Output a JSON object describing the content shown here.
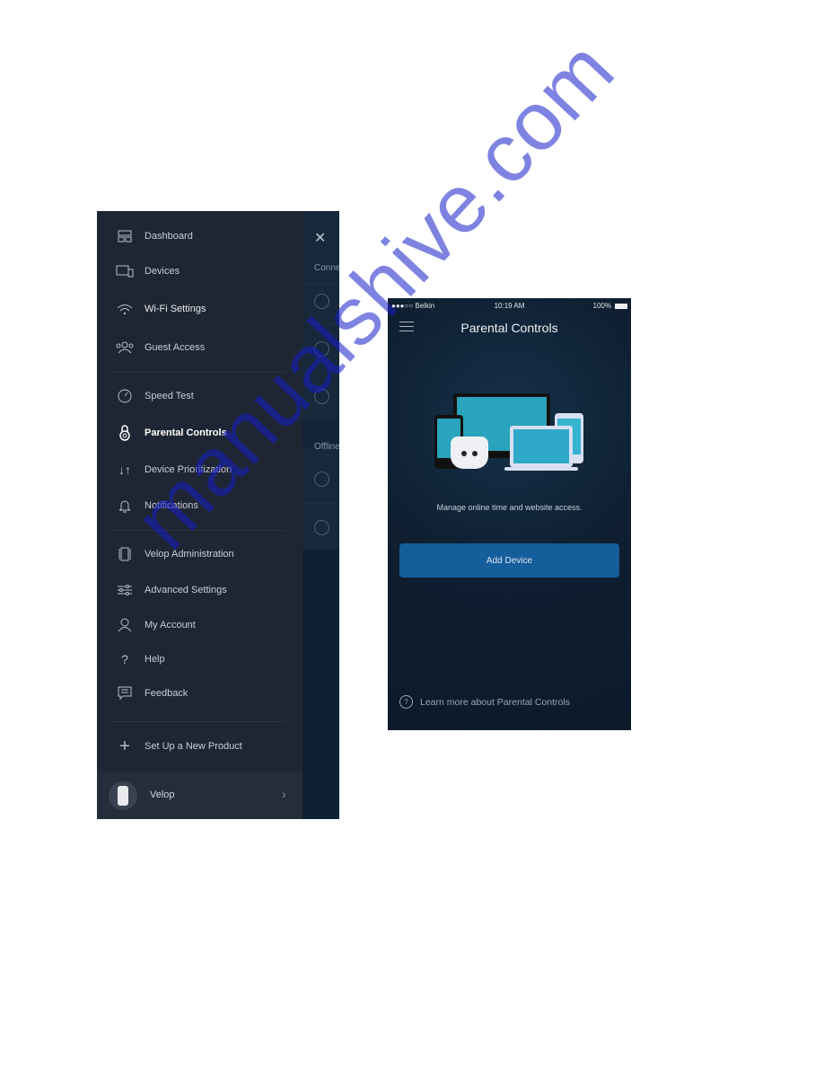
{
  "menu_screen": {
    "items": [
      {
        "label": "Dashboard",
        "icon": "dashboard-icon"
      },
      {
        "label": "Devices",
        "icon": "devices-icon"
      },
      {
        "label": "Wi-Fi Settings",
        "icon": "wifi-icon"
      },
      {
        "label": "Guest Access",
        "icon": "guest-icon"
      },
      {
        "label": "Speed Test",
        "icon": "speedometer-icon"
      },
      {
        "label": "Parental Controls",
        "icon": "lock-icon",
        "active": true
      },
      {
        "label": "Device Prioritization",
        "icon": "arrows-icon"
      },
      {
        "label": "Notifications",
        "icon": "bell-icon"
      },
      {
        "label": "Velop Administration",
        "icon": "node-icon"
      },
      {
        "label": "Advanced Settings",
        "icon": "sliders-icon"
      },
      {
        "label": "My Account",
        "icon": "user-icon"
      },
      {
        "label": "Help",
        "icon": "question-icon"
      },
      {
        "label": "Feedback",
        "icon": "chat-icon"
      },
      {
        "label": "Set Up a New Product",
        "icon": "plus-icon"
      }
    ],
    "footer": {
      "label": "Velop",
      "chevron": "›"
    },
    "behind": {
      "close": "✕",
      "connected_label": "Conne",
      "offline_label": "Offline"
    }
  },
  "parental_screen": {
    "status_bar": {
      "carrier": "●●●○○ Belkin",
      "time": "10:19 AM",
      "battery": "100%"
    },
    "title": "Parental Controls",
    "description": "Manage online time and website access.",
    "add_device": "Add Device",
    "learn_more": "Learn more about Parental Controls",
    "accent": "#165d9c"
  },
  "watermark": "manualshive.com"
}
